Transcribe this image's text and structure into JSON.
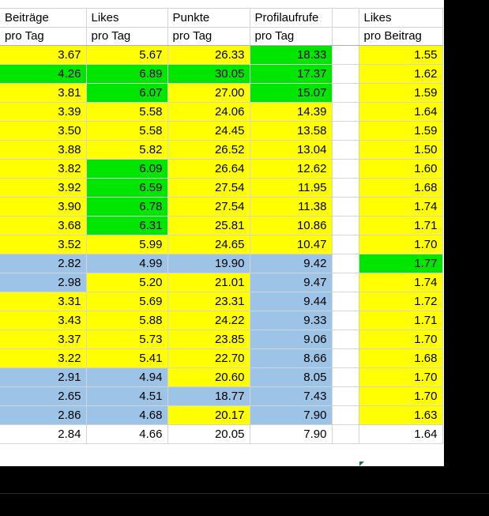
{
  "headers": [
    {
      "line1": "Beiträge",
      "line2": "pro Tag"
    },
    {
      "line1": "Likes",
      "line2": "pro Tag"
    },
    {
      "line1": "Punkte",
      "line2": "pro Tag"
    },
    {
      "line1": "Profilaufrufe",
      "line2": "pro Tag"
    },
    {
      "line1": "",
      "line2": ""
    },
    {
      "line1": "Likes",
      "line2": "pro Beitrag"
    }
  ],
  "colors": {
    "yellow": "#ffff00",
    "green": "#00e600",
    "blue": "#9dc3e6",
    "white": "#ffffff"
  },
  "rows": [
    {
      "values": [
        "3.67",
        "5.67",
        "26.33",
        "18.33",
        "1.55"
      ],
      "fills": [
        "y",
        "y",
        "y",
        "g",
        "y"
      ]
    },
    {
      "values": [
        "4.26",
        "6.89",
        "30.05",
        "17.37",
        "1.62"
      ],
      "fills": [
        "g",
        "g",
        "g",
        "g",
        "y"
      ]
    },
    {
      "values": [
        "3.81",
        "6.07",
        "27.00",
        "15.07",
        "1.59"
      ],
      "fills": [
        "y",
        "g",
        "y",
        "g",
        "y"
      ]
    },
    {
      "values": [
        "3.39",
        "5.58",
        "24.06",
        "14.39",
        "1.64"
      ],
      "fills": [
        "y",
        "y",
        "y",
        "y",
        "y"
      ]
    },
    {
      "values": [
        "3.50",
        "5.58",
        "24.45",
        "13.58",
        "1.59"
      ],
      "fills": [
        "y",
        "y",
        "y",
        "y",
        "y"
      ]
    },
    {
      "values": [
        "3.88",
        "5.82",
        "26.52",
        "13.04",
        "1.50"
      ],
      "fills": [
        "y",
        "y",
        "y",
        "y",
        "y"
      ]
    },
    {
      "values": [
        "3.82",
        "6.09",
        "26.64",
        "12.62",
        "1.60"
      ],
      "fills": [
        "y",
        "g",
        "y",
        "y",
        "y"
      ]
    },
    {
      "values": [
        "3.92",
        "6.59",
        "27.54",
        "11.95",
        "1.68"
      ],
      "fills": [
        "y",
        "g",
        "y",
        "y",
        "y"
      ]
    },
    {
      "values": [
        "3.90",
        "6.78",
        "27.54",
        "11.38",
        "1.74"
      ],
      "fills": [
        "y",
        "g",
        "y",
        "y",
        "y"
      ]
    },
    {
      "values": [
        "3.68",
        "6.31",
        "25.81",
        "10.86",
        "1.71"
      ],
      "fills": [
        "y",
        "g",
        "y",
        "y",
        "y"
      ]
    },
    {
      "values": [
        "3.52",
        "5.99",
        "24.65",
        "10.47",
        "1.70"
      ],
      "fills": [
        "y",
        "y",
        "y",
        "y",
        "y"
      ]
    },
    {
      "values": [
        "2.82",
        "4.99",
        "19.90",
        "9.42",
        "1.77"
      ],
      "fills": [
        "b",
        "b",
        "b",
        "b",
        "g"
      ]
    },
    {
      "values": [
        "2.98",
        "5.20",
        "21.01",
        "9.47",
        "1.74"
      ],
      "fills": [
        "b",
        "y",
        "y",
        "b",
        "y"
      ]
    },
    {
      "values": [
        "3.31",
        "5.69",
        "23.31",
        "9.44",
        "1.72"
      ],
      "fills": [
        "y",
        "y",
        "y",
        "b",
        "y"
      ]
    },
    {
      "values": [
        "3.43",
        "5.88",
        "24.22",
        "9.33",
        "1.71"
      ],
      "fills": [
        "y",
        "y",
        "y",
        "b",
        "y"
      ]
    },
    {
      "values": [
        "3.37",
        "5.73",
        "23.85",
        "9.06",
        "1.70"
      ],
      "fills": [
        "y",
        "y",
        "y",
        "b",
        "y"
      ]
    },
    {
      "values": [
        "3.22",
        "5.41",
        "22.70",
        "8.66",
        "1.68"
      ],
      "fills": [
        "y",
        "y",
        "y",
        "b",
        "y"
      ]
    },
    {
      "values": [
        "2.91",
        "4.94",
        "20.60",
        "8.05",
        "1.70"
      ],
      "fills": [
        "b",
        "b",
        "y",
        "b",
        "y"
      ]
    },
    {
      "values": [
        "2.65",
        "4.51",
        "18.77",
        "7.43",
        "1.70"
      ],
      "fills": [
        "b",
        "b",
        "b",
        "b",
        "y"
      ]
    },
    {
      "values": [
        "2.86",
        "4.68",
        "20.17",
        "7.90",
        "1.63"
      ],
      "fills": [
        "b",
        "b",
        "y",
        "b",
        "y"
      ]
    },
    {
      "values": [
        "2.84",
        "4.66",
        "20.05",
        "7.90",
        "1.64"
      ],
      "fills": [
        "w",
        "w",
        "w",
        "w",
        "w"
      ]
    }
  ]
}
